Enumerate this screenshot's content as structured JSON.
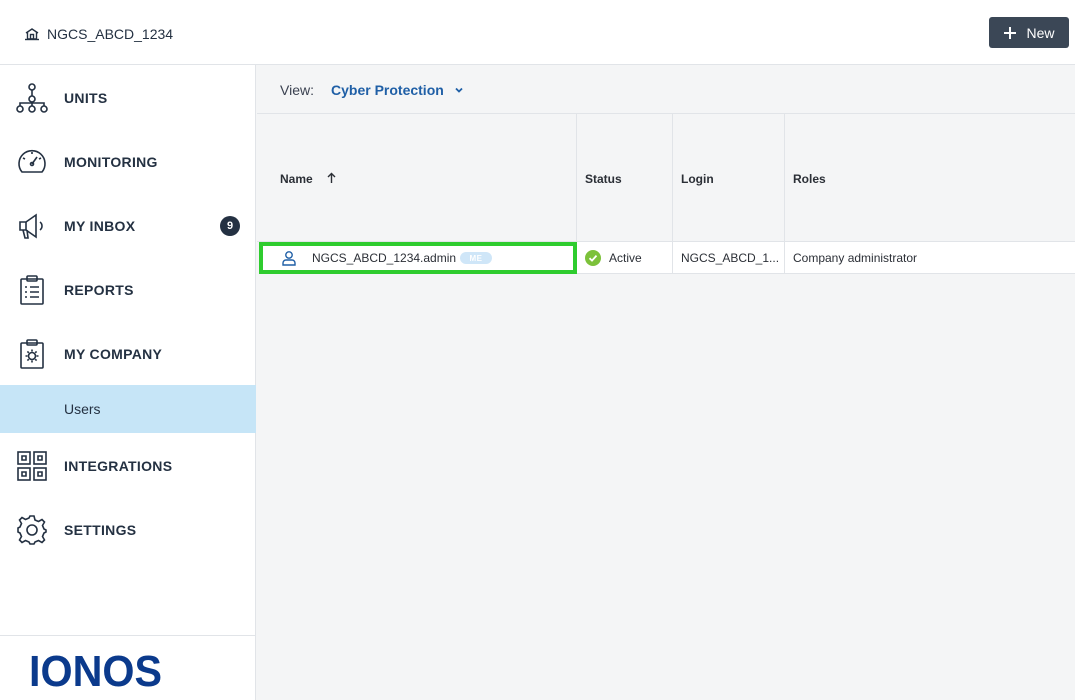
{
  "header": {
    "breadcrumb": "NGCS_ABCD_1234",
    "new_label": "New"
  },
  "sidebar": {
    "items": [
      {
        "label": "UNITS",
        "icon": "org-tree-icon"
      },
      {
        "label": "MONITORING",
        "icon": "speedometer-icon"
      },
      {
        "label": "MY INBOX",
        "icon": "megaphone-icon",
        "badge": "9"
      },
      {
        "label": "REPORTS",
        "icon": "clipboard-report-icon"
      },
      {
        "label": "MY COMPANY",
        "icon": "clipboard-gear-icon"
      },
      {
        "label": "INTEGRATIONS",
        "icon": "integrations-grid-icon"
      },
      {
        "label": "SETTINGS",
        "icon": "gear-icon"
      }
    ],
    "sub_item": "Users",
    "logo_text": "IONOS"
  },
  "view": {
    "label": "View:",
    "selected": "Cyber Protection"
  },
  "table": {
    "columns": [
      "Name",
      "Status",
      "Login",
      "Roles"
    ],
    "rows": [
      {
        "name": "NGCS_ABCD_1234.admin",
        "tag": "ME",
        "status": "Active",
        "login": "NGCS_ABCD_1...",
        "roles": "Company administrator"
      }
    ]
  },
  "colors": {
    "accent": "#1f5fa6",
    "selected_bg": "#c6e5f7",
    "highlight_border": "#2ecc2e",
    "status_active": "#7cc13a",
    "dark": "#243142"
  }
}
